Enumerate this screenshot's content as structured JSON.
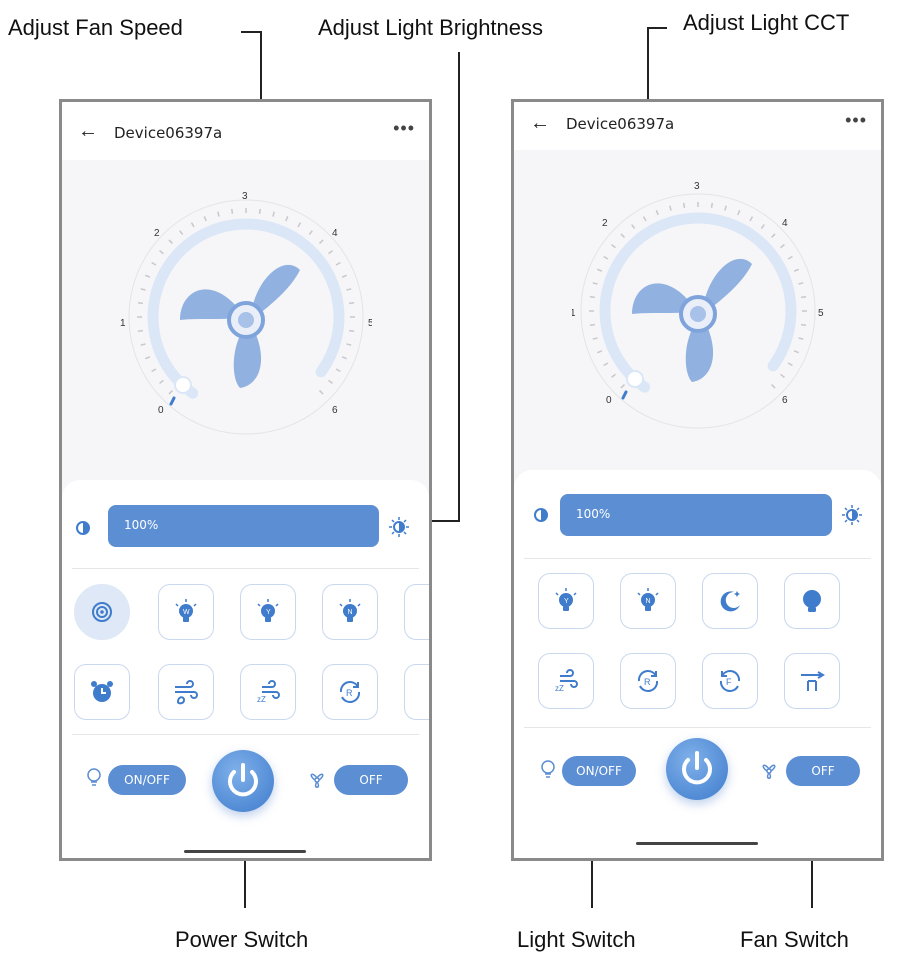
{
  "callouts": {
    "fan_speed": "Adjust  Fan Speed",
    "brightness": "Adjust Light Brightness",
    "cct": "Adjust Light CCT",
    "power": "Power Switch",
    "light": "Light Switch",
    "fan": "Fan Switch"
  },
  "phones": [
    {
      "title": "Device06397a",
      "brightness": "100%",
      "light_switch": "ON/OFF",
      "fan_switch": "OFF",
      "dial_labels": [
        "0",
        "1",
        "2",
        "3",
        "4",
        "5",
        "6"
      ],
      "row1_icons": [
        "bluetooth-pair-icon",
        "bulb-w-icon",
        "bulb-y-icon",
        "bulb-n-icon"
      ],
      "row2_icons": [
        "alarm-clock-icon",
        "wind-natural-icon",
        "wind-sleep-icon",
        "reverse-r-icon"
      ]
    },
    {
      "title": "Device06397a",
      "brightness": "100%",
      "light_switch": "ON/OFF",
      "fan_switch": "OFF",
      "dial_labels": [
        "0",
        "1",
        "2",
        "3",
        "4",
        "5",
        "6"
      ],
      "row1_icons": [
        "bulb-y-icon",
        "bulb-n-icon",
        "moon-icon",
        "bulb-solid-icon"
      ],
      "row2_icons": [
        "wind-sleep-icon",
        "reverse-r-icon",
        "forward-f-icon",
        "fan-mount-icon"
      ]
    }
  ],
  "colors": {
    "accent": "#5b8ed3",
    "frame": "#8a8a8a",
    "dial_arc": "#dbe7f7"
  }
}
